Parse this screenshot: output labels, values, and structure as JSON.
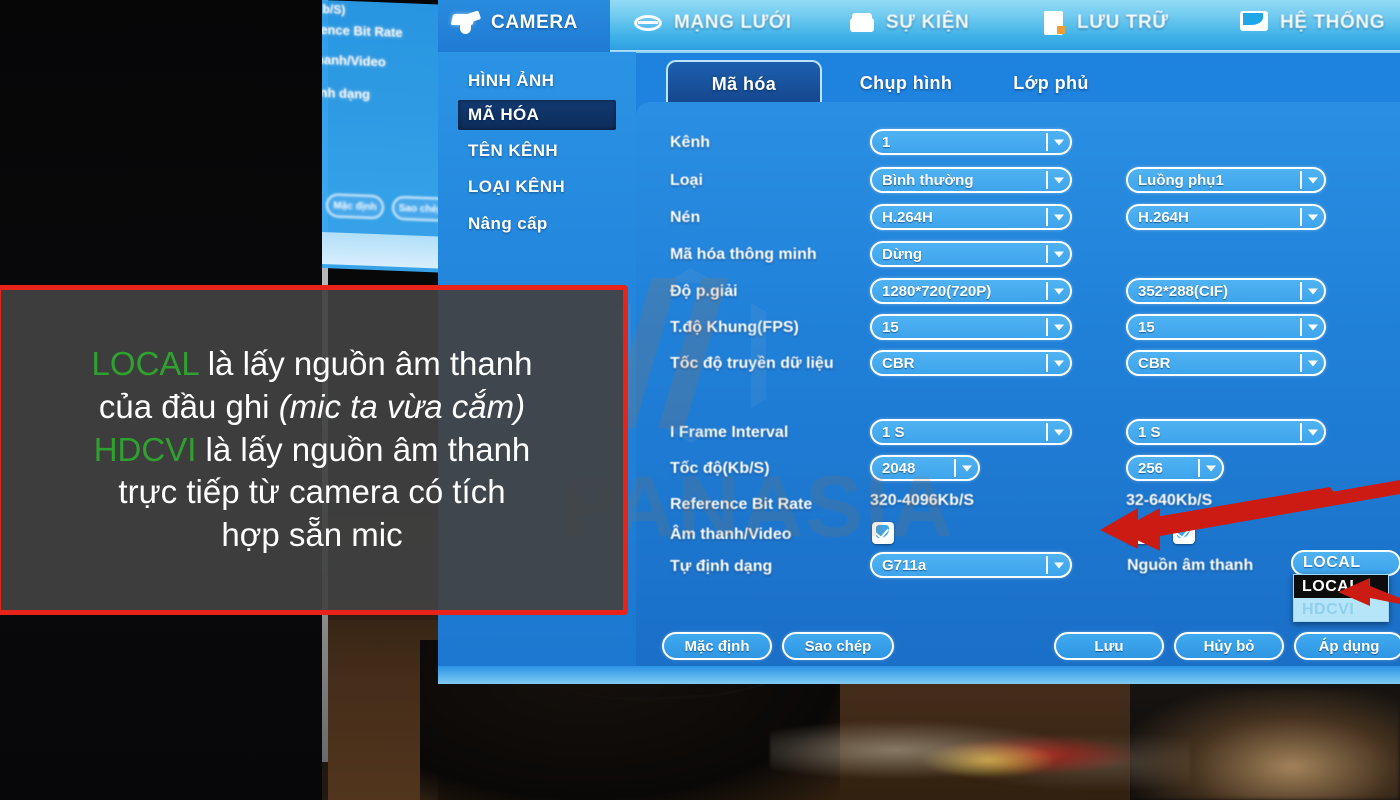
{
  "header": {
    "menu": [
      {
        "label": "CAMERA",
        "icon": "camera-icon",
        "active": true
      },
      {
        "label": "MẠNG LƯỚI",
        "icon": "network-icon",
        "active": false
      },
      {
        "label": "SỰ KIỆN",
        "icon": "event-icon",
        "active": false
      },
      {
        "label": "LƯU TRỮ",
        "icon": "storage-icon",
        "active": false
      },
      {
        "label": "HỆ THỐNG",
        "icon": "system-icon",
        "active": false
      }
    ]
  },
  "sidebar": {
    "items": [
      {
        "label": "HÌNH ẢNH",
        "selected": false
      },
      {
        "label": "MÃ HÓA",
        "selected": true
      },
      {
        "label": "TÊN KÊNH",
        "selected": false
      },
      {
        "label": "LOẠI KÊNH",
        "selected": false
      },
      {
        "label": "Nâng cấp",
        "selected": false
      }
    ]
  },
  "tabs": [
    {
      "label": "Mã hóa",
      "active": true
    },
    {
      "label": "Chụp hình",
      "active": false
    },
    {
      "label": "Lớp phủ",
      "active": false
    }
  ],
  "form": {
    "rows": [
      {
        "label": "Kênh",
        "main": "1",
        "sub": null
      },
      {
        "label": "Loại",
        "main": "Bình thường",
        "sub": "Luồng phụ1"
      },
      {
        "label": "Nén",
        "main": "H.264H",
        "sub": "H.264H"
      },
      {
        "label": "Mã hóa thông minh",
        "main": "Dừng",
        "sub": null
      },
      {
        "label": "Độ p.giải",
        "main": "1280*720(720P)",
        "sub": "352*288(CIF)"
      },
      {
        "label": "T.độ Khung(FPS)",
        "main": "15",
        "sub": "15"
      },
      {
        "label": "Tốc độ truyền dữ liệu",
        "main": "CBR",
        "sub": "CBR"
      },
      {
        "label": "I Frame Interval",
        "main": "1 S",
        "sub": "1 S"
      },
      {
        "label": "Tốc độ(Kb/S)",
        "main": "2048",
        "sub": "256"
      }
    ],
    "reference": {
      "label": "Reference Bit Rate",
      "main_value": "320-4096Kb/S",
      "sub_value": "32-640Kb/S"
    },
    "audio_video": {
      "label": "Âm thanh/Video"
    },
    "encoding_format": {
      "label": "Tự định dạng",
      "value": "G711a"
    },
    "audio_source": {
      "label": "Nguồn âm thanh",
      "selected": "LOCAL",
      "options": [
        {
          "label": "LOCAL",
          "selected": true
        },
        {
          "label": "HDCVI",
          "selected": false
        }
      ]
    }
  },
  "footer": {
    "buttons": [
      {
        "label": "Mặc định"
      },
      {
        "label": "Sao chép"
      },
      {
        "label": "Lưu"
      },
      {
        "label": "Hủy bỏ"
      },
      {
        "label": "Áp dụng"
      }
    ]
  },
  "ghost_panel": {
    "lines": [
      "(Kb/S)",
      "Reference Bit Rate",
      "Âm thanh/Video",
      "Tự định dạng"
    ],
    "buttons": [
      "Mặc định",
      "Sao chép"
    ]
  },
  "watermark": {
    "text": "PANASIA"
  },
  "subtitle": {
    "line1_kw": "LOCAL",
    "line1_rest": " là lấy nguồn âm thanh",
    "line2_plain": "của đầu ghi ",
    "line2_italic": "(mic ta vừa cắm)",
    "line3_kw": "HDCVI",
    "line3_rest": " là lấy nguồn âm thanh",
    "line4": "trực tiếp từ camera có tích",
    "line5": "hợp sẵn mic"
  },
  "colors": {
    "accent_blue": "#1f83e0",
    "highlight_dark": "#0d2c59",
    "keyword_green": "#2fa12f",
    "arrow_red": "#cc1b12",
    "subtitle_border": "#e8241a"
  }
}
